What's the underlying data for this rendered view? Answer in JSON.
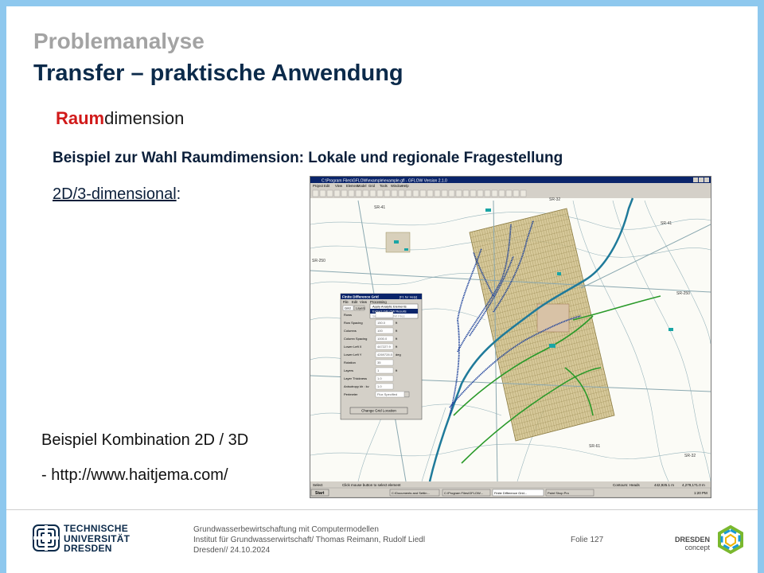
{
  "slide": {
    "super_title": "Problemanalyse",
    "title": "Transfer – praktische Anwendung",
    "subtitle_highlight": "Raum",
    "subtitle_rest": "dimension",
    "example_heading": "Beispiel zur Wahl Raumdimension: Lokale und regionale Fragestellung",
    "dims_label": "2D/3-dimensional",
    "dims_suffix": ":",
    "combo_label": "Beispiel Kombination 2D / 3D",
    "url_line": "- http://www.haitjema.com/"
  },
  "footer": {
    "line1": "Grundwasserbewirtschaftung mit Computermodellen",
    "line2": "Institut für Grundwasserwirtschaft/ Thomas Reimann, Rudolf Liedl",
    "line3": "Dresden// 24.10.2024",
    "page": "Folie 127",
    "tu_line1": "TECHNISCHE",
    "tu_line2": "UNIVERSITÄT",
    "tu_line3": "DRESDEN",
    "dd_line1": "DRESDEN",
    "dd_line2": "concept"
  },
  "screenshot": {
    "window_title": "C:\\Program Files\\GFLOW\\example\\example.gfl - GFLOW Version 2.1.0",
    "menu_items": [
      "Project",
      "Edit",
      "View",
      "Element",
      "Model",
      "Grid",
      "Tools",
      "Window",
      "Help"
    ],
    "dialog": {
      "title": "Finite Difference Grid",
      "help": "[F1 for Help]",
      "menu": [
        "File",
        "Edit",
        "View",
        "Processing"
      ],
      "dropdown_items": [
        "Apply Analytic Elements",
        "Extract GFLOW Results",
        "Save MODFLOW Files"
      ],
      "tabs": [
        "Grid",
        "Layers"
      ],
      "fields": [
        {
          "label": "Rows",
          "value": ""
        },
        {
          "label": "Row Spacing",
          "value": "150.0"
        },
        {
          "label": "Columns",
          "value": "100"
        },
        {
          "label": "Column Spacing",
          "value": "1000.0"
        },
        {
          "label": "Lower Left X",
          "value": "447227.9"
        },
        {
          "label": "Lower Left Y",
          "value": "4269728.5"
        },
        {
          "label": "Rotation",
          "value": "35"
        },
        {
          "label": "Layers",
          "value": "1"
        },
        {
          "label": "Layer Thickness",
          "value": "1.0"
        },
        {
          "label": "Anisotropy kh : kv",
          "value": "1.0"
        },
        {
          "label": "Perimeter",
          "value": "Flux Specified"
        }
      ],
      "units": [
        "ft",
        "ft",
        "ft",
        "ft",
        "deg",
        "",
        "ft"
      ],
      "button": "Change Grid Location"
    },
    "status": {
      "select": "Select",
      "hint": "Click mouse button to select element",
      "contours": "Contours: Heads",
      "x": "442,925.1 m",
      "y": "4,279,171.0 m"
    },
    "taskbar": {
      "start": "Start",
      "tasks": [
        "C:\\Documents and Settin...",
        "C:\\Program Files\\GFLOW...",
        "Finite Difference Grid...",
        "Paint Shop Pro"
      ],
      "clock": "1:20 PM"
    },
    "map_labels": [
      "SR-250",
      "SR-250",
      "SR-32",
      "SR-32",
      "SR-41",
      "SR-41",
      "SR-61"
    ],
    "colors": {
      "grid_fill": "#c9b77a",
      "river": "#1f7a9a",
      "drain": "#1a3f9a",
      "green_line": "#2a9a2a",
      "road": "#8aa8b0",
      "contour": "#9ab6bd"
    }
  }
}
